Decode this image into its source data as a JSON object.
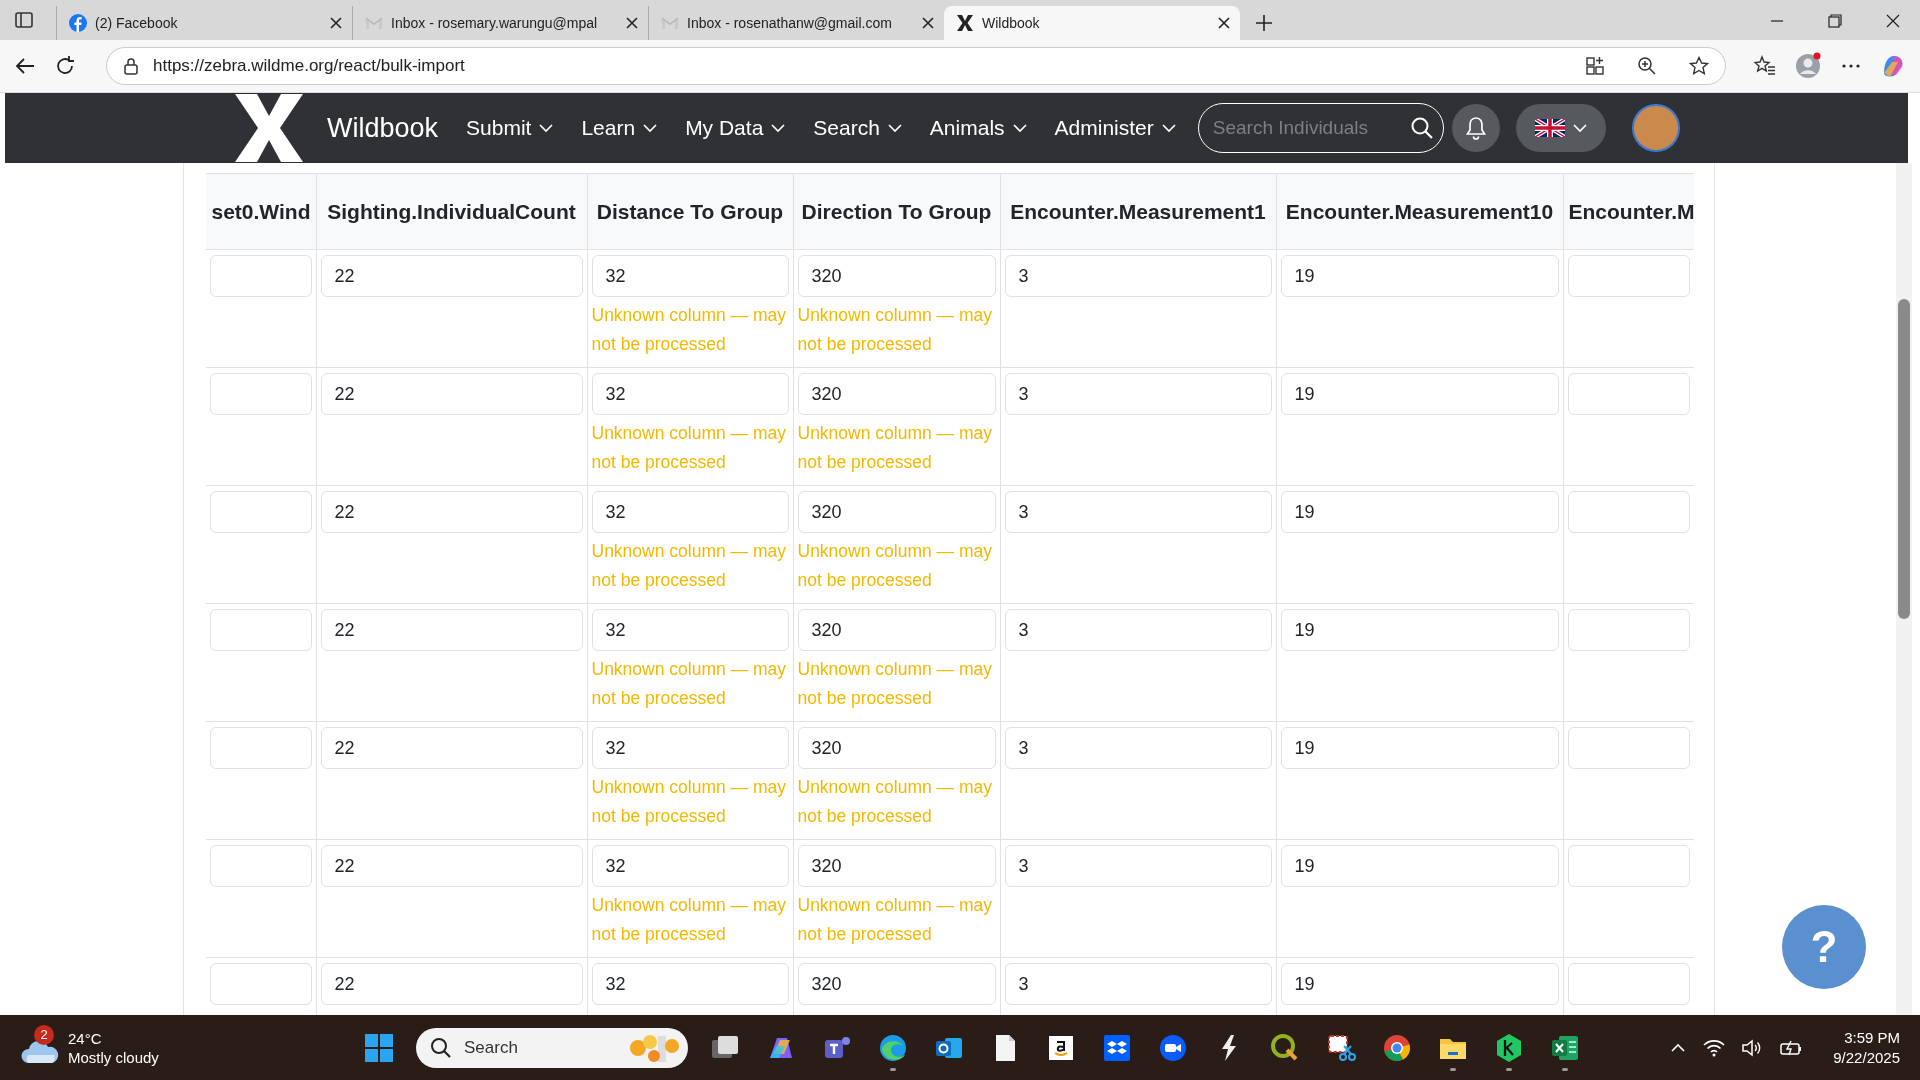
{
  "browser": {
    "tabs": [
      {
        "title": "(2) Facebook",
        "selected": false
      },
      {
        "title": "Inbox - rosemary.warungu@mpal",
        "selected": false
      },
      {
        "title": "Inbox - rosenathanw@gmail.com",
        "selected": false
      },
      {
        "title": "Wildbook",
        "selected": true
      }
    ],
    "url": "https://zebra.wildme.org/react/bulk-import"
  },
  "navbar": {
    "brand": "Wildbook",
    "menu": [
      "Submit",
      "Learn",
      "My Data",
      "Search",
      "Animals",
      "Administer"
    ],
    "search": {
      "placeholder": "Search Individuals"
    }
  },
  "table": {
    "columns": [
      "set0.Wind",
      "Sighting.IndividualCount",
      "Distance To Group",
      "Direction To Group",
      "Encounter.Measurement1",
      "Encounter.Measurement10",
      "Encounter.M"
    ],
    "rows": [
      {
        "cells": [
          {},
          {
            "value": "22"
          },
          {
            "value": "32",
            "warning": "Unknown column — may not be processed"
          },
          {
            "value": "320",
            "warning": "Unknown column — may not be processed"
          },
          {
            "value": "3"
          },
          {
            "value": "19"
          },
          {}
        ]
      },
      {
        "cells": [
          {},
          {
            "value": "22"
          },
          {
            "value": "32",
            "warning": "Unknown column — may not be processed"
          },
          {
            "value": "320",
            "warning": "Unknown column — may not be processed"
          },
          {
            "value": "3"
          },
          {
            "value": "19"
          },
          {}
        ]
      },
      {
        "cells": [
          {},
          {
            "value": "22"
          },
          {
            "value": "32",
            "warning": "Unknown column — may not be processed"
          },
          {
            "value": "320",
            "warning": "Unknown column — may not be processed"
          },
          {
            "value": "3"
          },
          {
            "value": "19"
          },
          {}
        ]
      },
      {
        "cells": [
          {},
          {
            "value": "22"
          },
          {
            "value": "32",
            "warning": "Unknown column — may not be processed"
          },
          {
            "value": "320",
            "warning": "Unknown column — may not be processed"
          },
          {
            "value": "3"
          },
          {
            "value": "19"
          },
          {}
        ]
      },
      {
        "cells": [
          {},
          {
            "value": "22"
          },
          {
            "value": "32",
            "warning": "Unknown column — may not be processed"
          },
          {
            "value": "320",
            "warning": "Unknown column — may not be processed"
          },
          {
            "value": "3"
          },
          {
            "value": "19"
          },
          {}
        ]
      },
      {
        "cells": [
          {},
          {
            "value": "22"
          },
          {
            "value": "32",
            "warning": "Unknown column — may not be processed"
          },
          {
            "value": "320",
            "warning": "Unknown column — may not be processed"
          },
          {
            "value": "3"
          },
          {
            "value": "19"
          },
          {}
        ]
      },
      {
        "cells": [
          {},
          {
            "value": "22"
          },
          {
            "value": "32"
          },
          {
            "value": "320"
          },
          {
            "value": "3"
          },
          {
            "value": "19"
          },
          {}
        ]
      }
    ]
  },
  "help_button": {
    "label": "?"
  },
  "taskbar": {
    "weather": {
      "badge": "2",
      "temperature": "24°C",
      "condition": "Mostly cloudy"
    },
    "search": {
      "placeholder": "Search"
    },
    "apps": [
      {
        "running": false
      },
      {
        "running": false
      },
      {
        "running": false
      },
      {
        "running": false
      },
      {
        "running": true
      },
      {
        "running": false
      },
      {
        "running": false
      },
      {
        "running": false
      },
      {
        "running": false
      },
      {
        "running": false
      },
      {
        "running": false
      },
      {
        "running": false
      },
      {
        "running": false
      },
      {
        "running": false
      },
      {
        "running": true
      },
      {
        "running": true
      },
      {
        "running": true
      }
    ],
    "time": "3:59 PM",
    "date": "9/22/2025"
  }
}
